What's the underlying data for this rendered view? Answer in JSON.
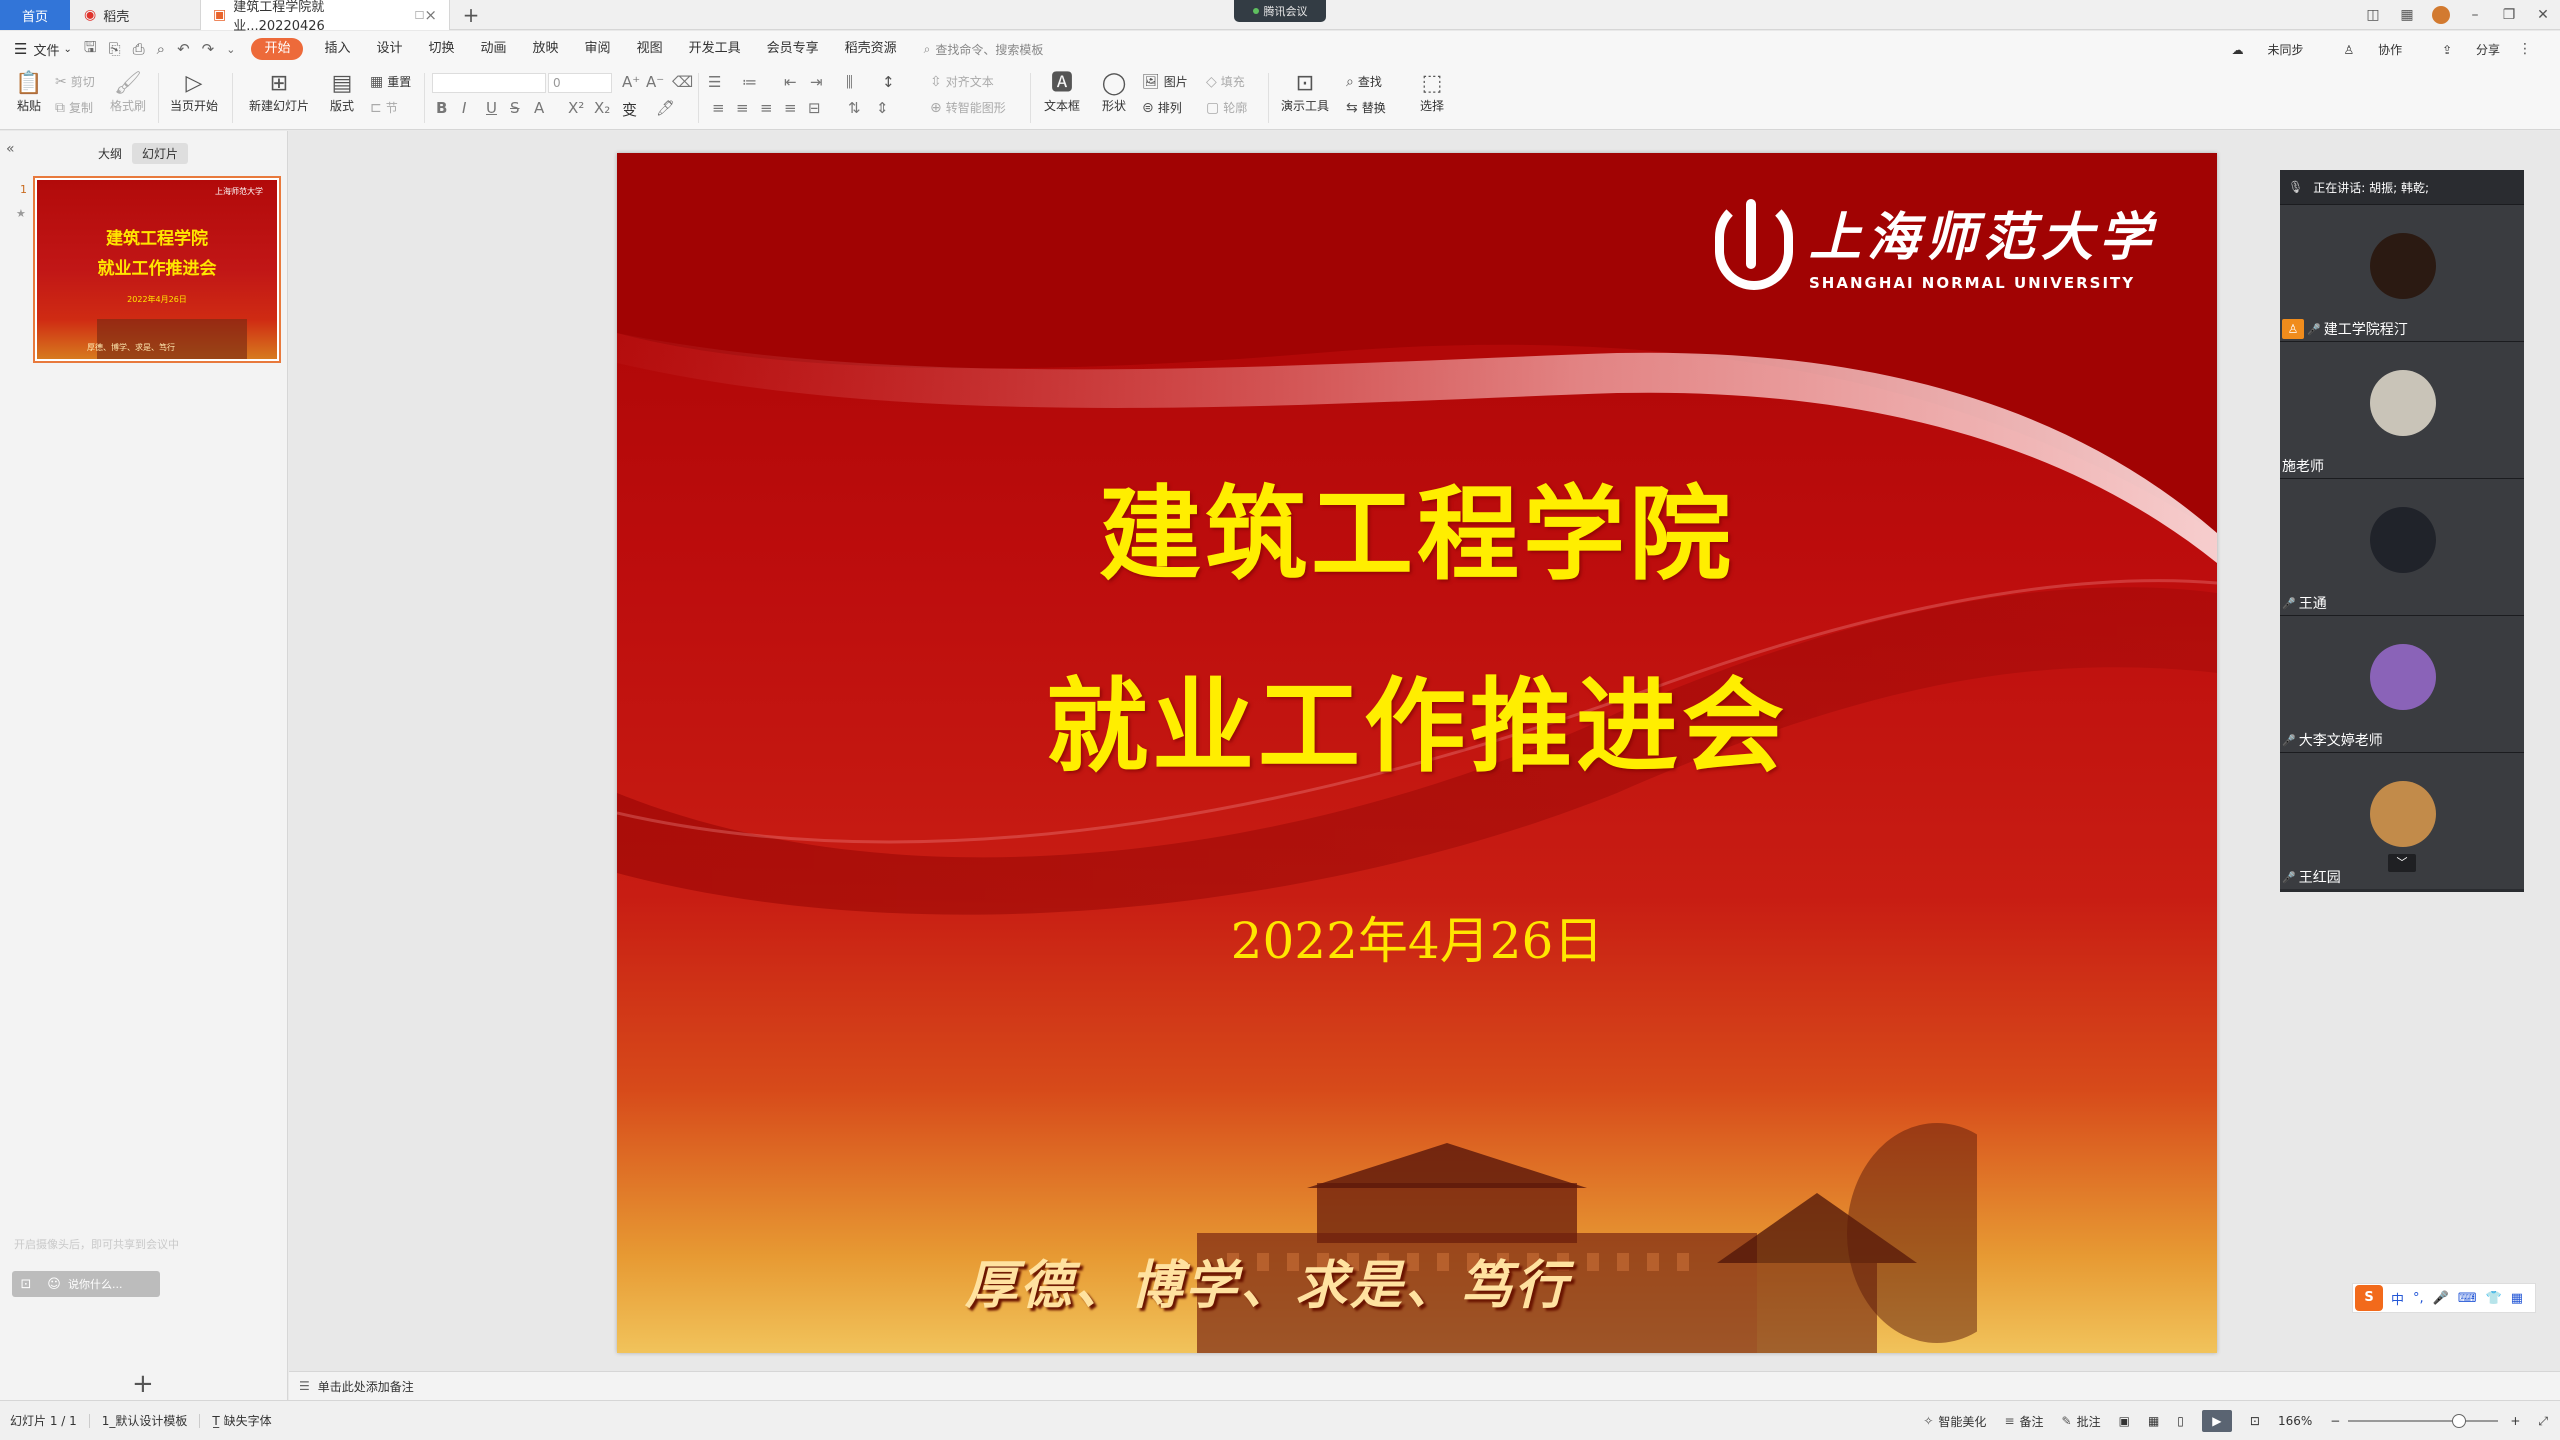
{
  "titlebar": {
    "tabs": [
      {
        "label": "首页"
      },
      {
        "label": "稻壳"
      },
      {
        "label": "建筑工程学院就业...20220426"
      }
    ],
    "meeting_label": "腾讯会议"
  },
  "menubar": {
    "file_label": "文件",
    "items": [
      "开始",
      "插入",
      "设计",
      "切换",
      "动画",
      "放映",
      "审阅",
      "视图",
      "开发工具",
      "会员专享",
      "稻壳资源"
    ],
    "search_placeholder": "查找命令、搜索模板",
    "right": {
      "sync": "未同步",
      "collab": "协作",
      "share": "分享"
    }
  },
  "ribbon": {
    "paste": "粘贴",
    "cut": "剪切",
    "copy": "复制",
    "format_painter": "格式刷",
    "from_current": "当页开始",
    "new_slide": "新建幻灯片",
    "layout": "版式",
    "section": "节",
    "reset": "重置",
    "font_size": "0",
    "align_text": "对齐文本",
    "smart_shape": "转智能图形",
    "textbox": "文本框",
    "shape": "形状",
    "picture": "图片",
    "arrange": "排列",
    "fill": "填充",
    "outline": "轮廓",
    "present_tools": "演示工具",
    "find": "查找",
    "replace": "替换",
    "select": "选择"
  },
  "leftpane": {
    "tab_outline": "大纲",
    "tab_slides": "幻灯片",
    "slide_number": "1",
    "ghost_hint": "开启摄像头后，即可共享到会议中",
    "search_placeholder": "说你什么..."
  },
  "slide": {
    "logo_cn": "上海师范大学",
    "logo_en": "SHANGHAI NORMAL UNIVERSITY",
    "title_line1": "建筑工程学院",
    "title_line2": "就业工作推进会",
    "date": "2022年4月26日",
    "motto": "厚德、博学、求是、笃行"
  },
  "notes": {
    "placeholder": "单击此处添加备注"
  },
  "meeting": {
    "speaking": "正在讲话: 胡振; 韩乾;",
    "participants": [
      {
        "name": "建工学院程汀",
        "color": "#2b1a12"
      },
      {
        "name": "施老师",
        "color": "#c9c4b8"
      },
      {
        "name": "王通",
        "color": "#20232a"
      },
      {
        "name": "大李文婷老师",
        "color": "#8a63b8"
      },
      {
        "name": "王红园",
        "color": "#c28b4a"
      }
    ]
  },
  "ime": {
    "lang": "中"
  },
  "status": {
    "slide_count": "幻灯片 1 / 1",
    "template": "1_默认设计模板",
    "missing_font": "缺失字体",
    "beautify": "智能美化",
    "notes": "备注",
    "comments": "批注",
    "zoom": "166%"
  }
}
